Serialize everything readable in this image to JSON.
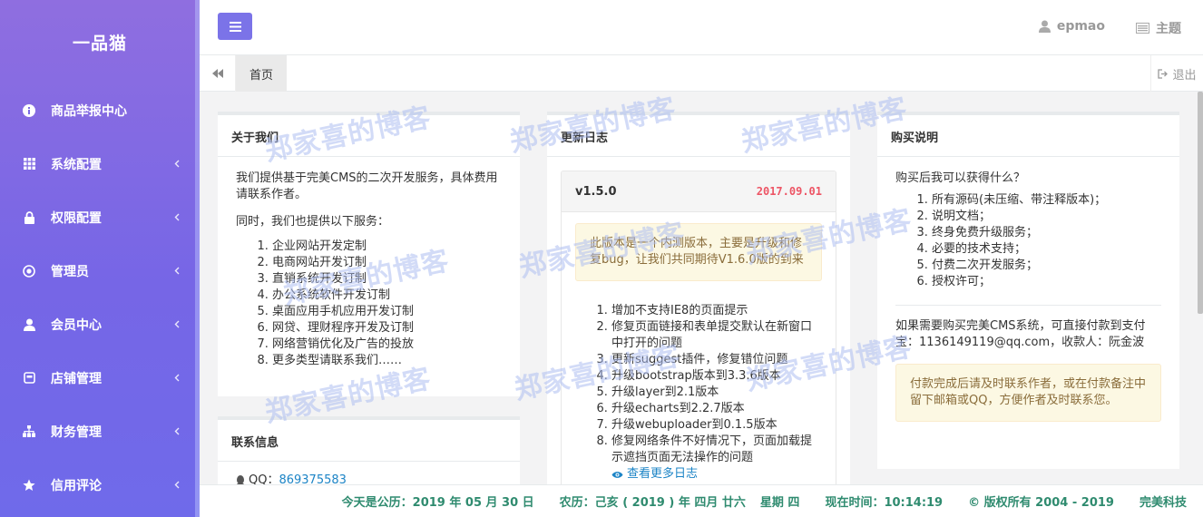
{
  "brand": "一品猫",
  "sidebar": {
    "items": [
      {
        "label": "商品举报中心",
        "icon": "info-icon",
        "has_chevron": false
      },
      {
        "label": "系统配置",
        "icon": "grid-icon",
        "has_chevron": true
      },
      {
        "label": "权限配置",
        "icon": "lock-icon",
        "has_chevron": true
      },
      {
        "label": "管理员",
        "icon": "target-icon",
        "has_chevron": true
      },
      {
        "label": "会员中心",
        "icon": "user-icon",
        "has_chevron": true
      },
      {
        "label": "店铺管理",
        "icon": "store-icon",
        "has_chevron": true
      },
      {
        "label": "财务管理",
        "icon": "sitemap-icon",
        "has_chevron": true
      },
      {
        "label": "信用评论",
        "icon": "star-icon",
        "has_chevron": true
      }
    ]
  },
  "header": {
    "username": "epmao",
    "theme_label": "主题"
  },
  "tabs": {
    "home_label": "首页",
    "logout_label": "退出"
  },
  "about": {
    "title": "关于我们",
    "intro": "我们提供基于完美CMS的二次开发服务，具体费用请联系作者。",
    "services_intro": "同时，我们也提供以下服务：",
    "services": [
      "企业网站开发定制",
      "电商网站开发订制",
      "直销系统开发订制",
      "办公系统软件开发订制",
      "桌面应用手机应用开发订制",
      "网贷、理财程序开发及订制",
      "网络营销优化及广告的投放",
      "更多类型请联系我们……"
    ]
  },
  "contact": {
    "title": "联系信息",
    "qq_label": "QQ：",
    "qq_value": "869375583"
  },
  "changelog": {
    "title": "更新日志",
    "version": "v1.5.0",
    "date": "2017.09.01",
    "notice": "此版本是一个内测版本，主要是升级和修复bug，让我们共同期待V1.6.0版的到来",
    "items": [
      "增加不支持IE8的页面提示",
      "修复页面链接和表单提交默认在新窗口中打开的问题",
      "更新suggest插件，修复错位问题",
      "升级bootstrap版本到3.3.6版本",
      "升级layer到2.1版本",
      "升级echarts到2.2.7版本",
      "升级webuploader到0.1.5版本",
      "修复网络条件不好情况下，页面加载提示遮挡页面无法操作的问题"
    ],
    "more_label": "查看更多日志"
  },
  "purchase": {
    "title": "购买说明",
    "question": "购买后我可以获得什么？",
    "benefits": [
      "所有源码(未压缩、带注释版本)；",
      "说明文档；",
      "终身免费升级服务；",
      "必要的技术支持；",
      "付费二次开发服务；",
      "授权许可；"
    ],
    "pay_info": "如果需要购买完美CMS系统，可直接付款到支付宝：1136149119@qq.com，收款人：阮金波",
    "pay_notice": "付款完成后请及时联系作者，或在付款备注中留下邮箱或QQ，方便作者及时联系您。"
  },
  "footer": {
    "solar": "今天是公历：2019 年 05 月 30 日",
    "lunar": "农历：己亥 ( 2019 ) 年  四月 廿六",
    "weekday": "星期 四",
    "time": "现在时间：10:14:19",
    "copyright": "© 版权所有 2004 - 2019",
    "company": "完美科技"
  },
  "watermark": "郑家喜的博客",
  "colors": {
    "accent": "#7b73e8",
    "date_red": "#ed5565",
    "link_blue": "#1c84c6",
    "footer_green": "#2f8b6f"
  }
}
